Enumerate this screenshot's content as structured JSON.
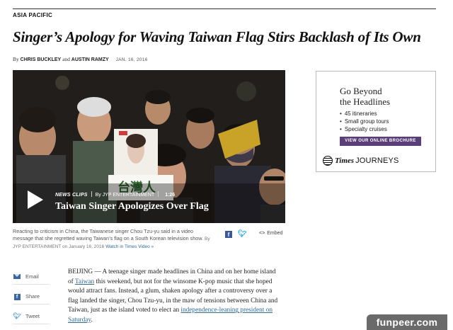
{
  "section": {
    "label": "ASIA PACIFIC"
  },
  "article": {
    "headline": "Singer’s Apology for Waving Taiwan Flag Stirs Backlash of Its Own",
    "byline_prefix": "By",
    "author_1": "CHRIS BUCKLEY",
    "byline_and": "and",
    "author_2": "AUSTIN RAMZY",
    "date": "JAN. 16, 2016",
    "body_dateline": "BEIJING — A teenage singer made headlines in China and on her home island of ",
    "body_link_1": "Taiwan",
    "body_mid": " this weekend, but not for the winsome K-pop music that she hoped would attract fans. Instead, a glum, shaken apology after a controversy over a flag landed the singer, Chou Tzu-yu, in the maw of tensions between China and Taiwan, just as the island voted to elect an ",
    "body_link_2": "independence-leaning president on Saturday",
    "body_end": "."
  },
  "video": {
    "kicker": "NEWS CLIPS",
    "source": "By JYP ENTERTAINMENT",
    "duration": "1:26",
    "title": "Taiwan Singer Apologizes Over Flag",
    "sign_text": "台灣人",
    "caption": "Reacting to criticism in China, the Taiwanese singer Chou Tzu-yu said in a video message that she regretted waving Taiwan’s flag on a South Korean television show.",
    "credit": "By JYP ENTERTAINMENT on January 16, 2016",
    "watch_link": "Watch in Times Video »",
    "embed_label": "Embed",
    "embed_code_glyph": "<>"
  },
  "ad": {
    "headline_line1": "Go Beyond",
    "headline_line2": "the Headlines",
    "bullets": [
      "45 itineraries",
      "Small group tours",
      "Specialty cruises"
    ],
    "button": "VIEW OUR ONLINE BROCHURE",
    "brand_times": "Times",
    "brand_journeys": "JOURNEYS"
  },
  "share_rail": {
    "items": [
      {
        "label": "Email",
        "icon": "email-icon"
      },
      {
        "label": "Share",
        "icon": "facebook-icon"
      },
      {
        "label": "Tweet",
        "icon": "twitter-icon"
      }
    ]
  },
  "watermark": {
    "text": "funpeer.com"
  },
  "colors": {
    "link": "#326891",
    "ad_button": "#5a3e7a",
    "facebook": "#3b5998",
    "twitter": "#1da1f2"
  }
}
